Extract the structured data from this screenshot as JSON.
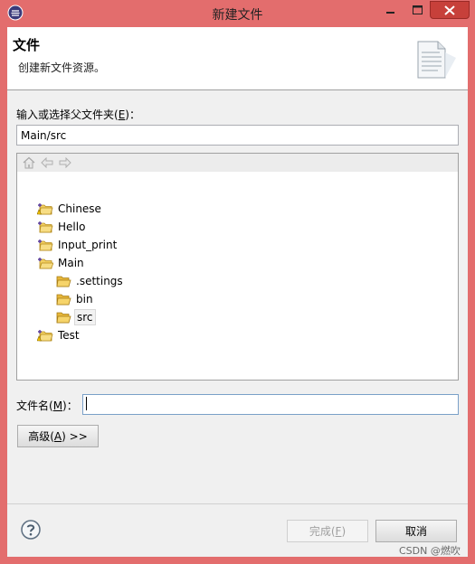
{
  "window": {
    "title": "新建文件",
    "app_icon": "eclipse-icon",
    "controls": {
      "minimize": "minimize-icon",
      "maximize": "maximize-icon",
      "close": "close-icon"
    }
  },
  "header": {
    "title": "文件",
    "description": "创建新文件资源。",
    "icon": "new-file-wizard-icon"
  },
  "parent_folder": {
    "label_prefix": "输入或选择父文件夹(",
    "label_mnemonic": "E",
    "label_suffix": ")：",
    "value": "Main/src"
  },
  "tree_toolbar": {
    "icons": [
      "home-icon",
      "back-arrow-icon",
      "forward-arrow-icon"
    ]
  },
  "tree": {
    "items": [
      {
        "label": "Chinese",
        "icon": "project-folder-warning-icon"
      },
      {
        "label": "Hello",
        "icon": "project-folder-icon"
      },
      {
        "label": "Input_print",
        "icon": "project-folder-icon"
      },
      {
        "label": "Main",
        "icon": "project-folder-open-icon",
        "expanded": true
      },
      {
        "label": ".settings",
        "icon": "folder-icon"
      },
      {
        "label": "bin",
        "icon": "folder-icon"
      },
      {
        "label": "src",
        "icon": "folder-icon",
        "selected": true
      },
      {
        "label": "Test",
        "icon": "project-folder-warning-icon"
      }
    ]
  },
  "file_name": {
    "label_prefix": "文件名(",
    "label_mnemonic": "M",
    "label_suffix": ")：",
    "value": ""
  },
  "advanced_button": {
    "label_prefix": "高级(",
    "label_mnemonic": "A",
    "label_suffix": ") >>"
  },
  "footer": {
    "help_icon": "help-icon",
    "finish_prefix": "完成(",
    "finish_mnemonic": "F",
    "finish_suffix": ")",
    "finish_enabled": false,
    "cancel_label": "取消"
  },
  "watermark": "CSDN @燃吹",
  "colors": {
    "titlebar": "#e36d6d",
    "close_button": "#c7403a",
    "dialog_bg": "#f0f0f0",
    "folder": "#e7b73a"
  }
}
